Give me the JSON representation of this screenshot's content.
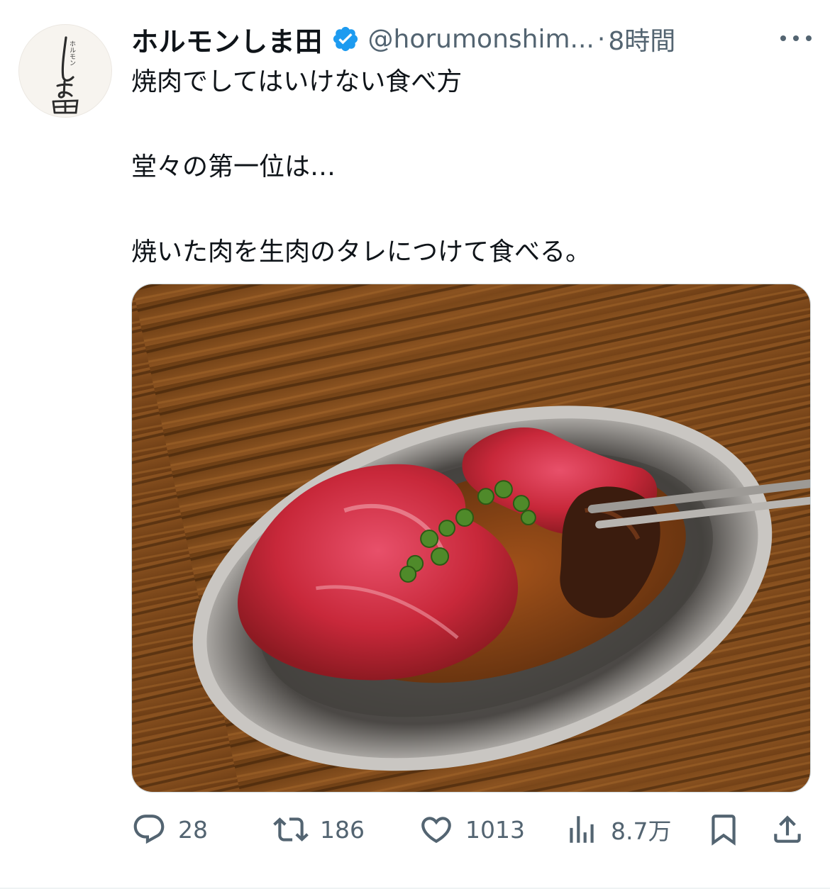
{
  "account": {
    "display_name": "ホルモンしま田",
    "handle": "@horumonshim...",
    "separator": "·",
    "timestamp": "8時間",
    "verified": true,
    "accent_color": "#1d9bf0",
    "avatar_logo_small": "ホルモン",
    "avatar_logo_main": "しま田"
  },
  "tweet": {
    "lines": [
      "焼肉でしてはいけない食べ方",
      "堂々の第一位は…",
      "焼いた肉を生肉のタレにつけて食べる。"
    ],
    "media_icon": "photo-grilled-meat-on-metal-plate"
  },
  "actions": {
    "reply_count": "28",
    "retweet_count": "186",
    "like_count": "1013",
    "view_count": "8.7万",
    "icons": [
      "reply-icon",
      "retweet-icon",
      "like-icon",
      "views-icon",
      "bookmark-icon",
      "share-icon"
    ]
  }
}
